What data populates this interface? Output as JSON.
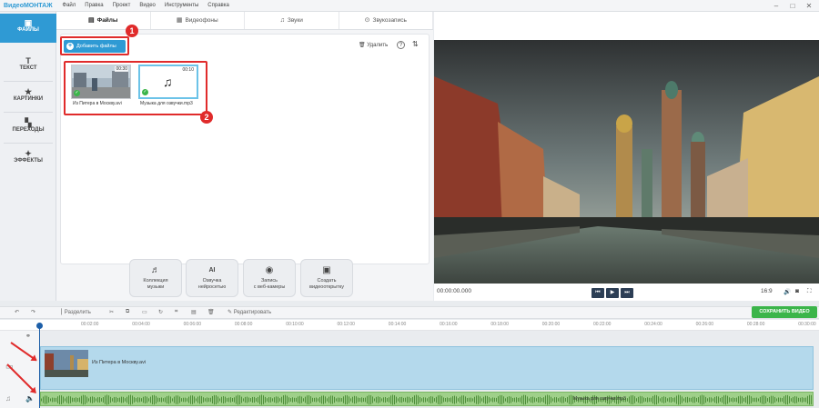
{
  "app": {
    "brand": "ВидеоМОНТАЖ"
  },
  "menu": [
    "Файл",
    "Правка",
    "Проект",
    "Видео",
    "Инструменты",
    "Справка"
  ],
  "window_controls": [
    "–",
    "□",
    "✕"
  ],
  "sidebar": {
    "items": [
      {
        "label": "ФАЙЛЫ",
        "icon": "files-icon",
        "glyph": "▣"
      },
      {
        "label": "ТЕКСТ",
        "icon": "text-icon",
        "glyph": "T"
      },
      {
        "label": "КАРТИНКИ",
        "icon": "star-icon",
        "glyph": "★"
      },
      {
        "label": "ПЕРЕХОДЫ",
        "icon": "transitions-icon",
        "glyph": "▚"
      },
      {
        "label": "ЭФФЕКТЫ",
        "icon": "effects-icon",
        "glyph": "✦"
      }
    ]
  },
  "tabs": [
    {
      "label": "Файлы",
      "icon": "folder-icon",
      "glyph": "▤"
    },
    {
      "label": "Видеофоны",
      "icon": "video-bg-icon",
      "glyph": "▦"
    },
    {
      "label": "Звуки",
      "icon": "sound-icon",
      "glyph": "♫"
    },
    {
      "label": "Звукозапись",
      "icon": "mic-icon",
      "glyph": "⊙"
    }
  ],
  "toolbar": {
    "add_files": "Добавить файлы",
    "delete": "Удалить",
    "help": "?",
    "sort": "⇅",
    "delete_glyph": "🗑"
  },
  "badges": {
    "one": "1",
    "two": "2"
  },
  "files": [
    {
      "name": "Из Питера в Москву.avi",
      "duration": "00:30"
    },
    {
      "name": "Музыка для озвучки.mp3",
      "duration": "00:10"
    }
  ],
  "actions": [
    {
      "label1": "Коллекция",
      "label2": "музыки",
      "glyph": "♬"
    },
    {
      "label1": "Озвучка",
      "label2": "нейросетью",
      "glyph": "AI"
    },
    {
      "label1": "Запись",
      "label2": "с веб-камеры",
      "glyph": "◉"
    },
    {
      "label1": "Создать",
      "label2": "видеооткрытку",
      "glyph": "▣"
    }
  ],
  "player": {
    "timecode": "00:00:00.000",
    "zoom": "16:9",
    "buttons": [
      "⏮",
      "▶",
      "⏭"
    ]
  },
  "timeline_toolbar": {
    "split": "Разделить",
    "edit": "Редактировать",
    "save": "СОХРАНИТЬ ВИДЕО"
  },
  "ruler": [
    "00:02:00",
    "00:04:00",
    "00:06:00",
    "00:08:00",
    "00:10:00",
    "00:12:00",
    "00:14:00",
    "00:16:00",
    "00:18:00",
    "00:20:00",
    "00:22:00",
    "00:24:00",
    "00:26:00",
    "00:28:00",
    "00:30:00"
  ],
  "tracks": {
    "video_clip": "Из Питера в Москву.avi",
    "audio_clip": "Музыка для озвучки.mp3"
  },
  "colors": {
    "accent": "#2f9ad4",
    "save": "#3bb54a",
    "annotation": "#e02b2b"
  }
}
